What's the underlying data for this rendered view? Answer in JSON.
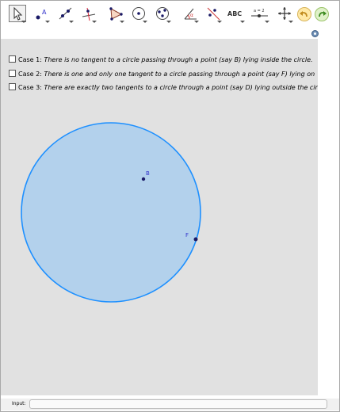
{
  "toolbar": {
    "tools": [
      {
        "name": "move",
        "icon": "cursor-arrow-icon",
        "selected": true
      },
      {
        "name": "point",
        "icon": "point-icon",
        "label": "A"
      },
      {
        "name": "line",
        "icon": "line-through-points-icon"
      },
      {
        "name": "perpendicular",
        "icon": "perpendicular-line-icon"
      },
      {
        "name": "polygon",
        "icon": "polygon-icon"
      },
      {
        "name": "circle-center-point",
        "icon": "circle-with-center-icon"
      },
      {
        "name": "circle-three-points",
        "icon": "circle-three-points-icon"
      },
      {
        "name": "angle",
        "icon": "angle-icon",
        "label": "α"
      },
      {
        "name": "reflect",
        "icon": "reflect-about-line-icon"
      },
      {
        "name": "text",
        "icon": "text-icon",
        "label": "ABC"
      },
      {
        "name": "slider",
        "icon": "slider-icon",
        "label": "a = 2"
      },
      {
        "name": "move-graphics-view",
        "icon": "move-graphics-view-icon"
      }
    ],
    "undo_icon": "undo-icon",
    "redo_icon": "redo-icon",
    "settings_icon": "settings-gear-icon"
  },
  "cases": [
    {
      "label": "Case 1:",
      "text": "There is no tangent to a circle passing through a point (say B) lying inside the circle."
    },
    {
      "label": "Case 2:",
      "text": "There is one and only one tangent to a circle passing through a point (say F) lying on"
    },
    {
      "label": "Case 3:",
      "text": "There are exactly two tangents to a circle through a point (say D) lying outside the cir"
    }
  ],
  "points": {
    "B": "B",
    "F": "F"
  },
  "colors": {
    "circle_stroke": "#1e90ff",
    "circle_fill": "#b3d1ec",
    "point": "#1a1a66",
    "label": "#3333cc"
  },
  "input_bar": {
    "label": "Input:",
    "value": ""
  }
}
